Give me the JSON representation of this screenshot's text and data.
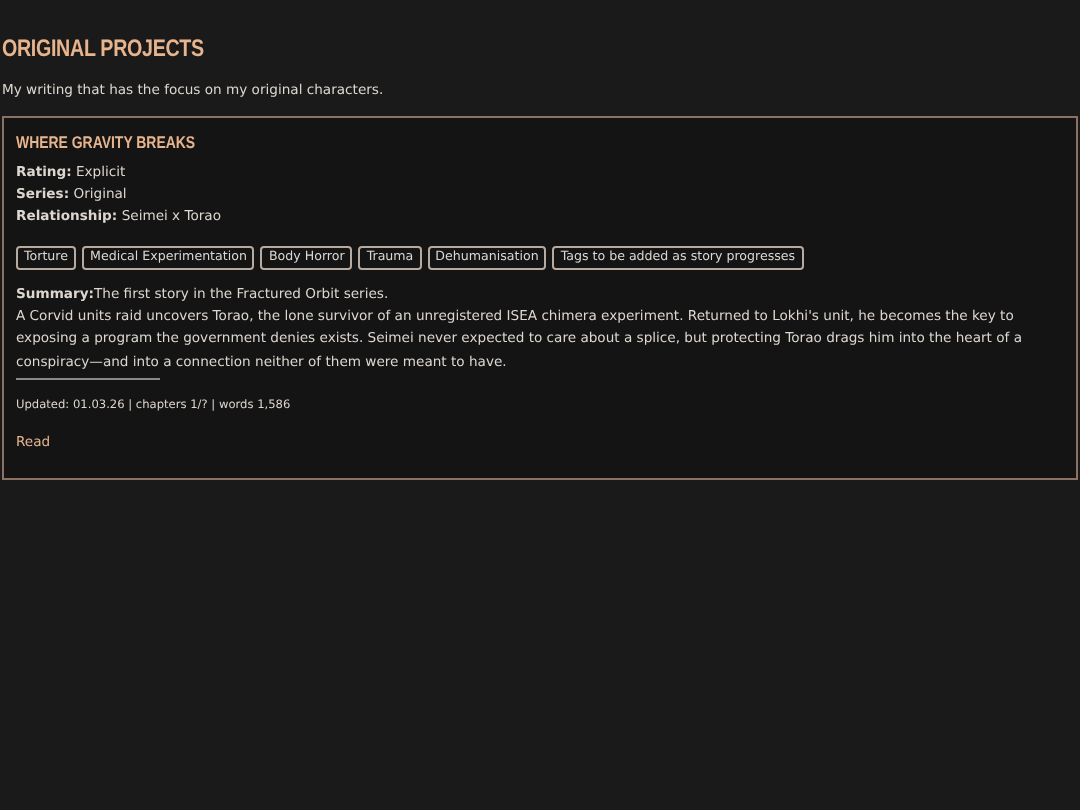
{
  "page": {
    "title": "ORIGINAL PROJECTS",
    "description": "My writing that has the focus on my original characters."
  },
  "works": [
    {
      "title": "WHERE GRAVITY BREAKS",
      "meta": [
        {
          "label": "Rating:",
          "value": "Explicit"
        },
        {
          "label": "Series:",
          "value": "Original"
        },
        {
          "label": "Relationship:",
          "value": "Seimei x Torao"
        }
      ],
      "tags": [
        "Torture",
        "Medical Experimentation",
        "Body Horror",
        "Trauma",
        "Dehumanisation",
        "Tags to be added as story progresses"
      ],
      "summary_label": "Summary:",
      "summary_intro": "The first story in the Fractured Orbit series.",
      "summary": "A Corvid units raid uncovers Torao, the lone survivor of an unregistered ISEA chimera experiment. Returned to Lokhi's unit, he becomes the key to exposing a program the government denies exists. Seimei never expected to care about a splice, but protecting Torao drags him into the heart of a conspiracy—and into a connection neither of them were meant to have.",
      "stats": "Updated: 01.03.26 | chapters 1/? | words 1,586",
      "link": "Read"
    }
  ]
}
